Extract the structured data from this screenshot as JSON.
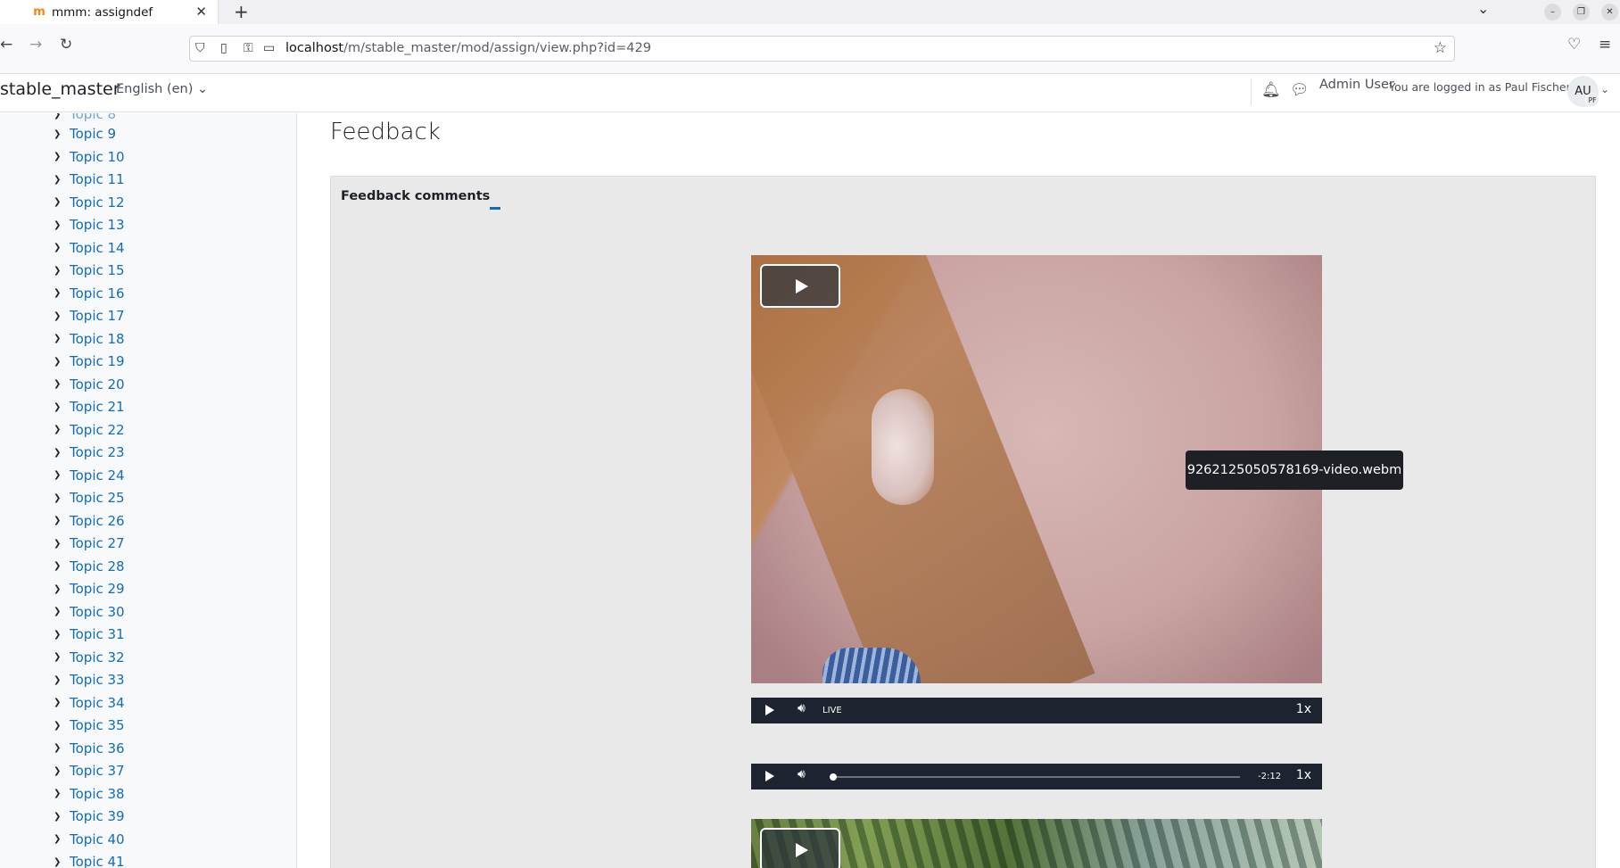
{
  "browser": {
    "tab_title": "mmm: assigndef",
    "url_host": "localhost",
    "url_path": "/m/stable_master/mod/assign/view.php?id=429"
  },
  "header": {
    "site_name": "stable_master",
    "language": "English (en) ⌄",
    "user_name": "Admin User",
    "logged_in_as": "You are logged in as Paul Fischer",
    "avatar_initials": "AU",
    "avatar_sub_initials": "PF"
  },
  "sidebar": {
    "topics": [
      "Topic 9",
      "Topic 10",
      "Topic 11",
      "Topic 12",
      "Topic 13",
      "Topic 14",
      "Topic 15",
      "Topic 16",
      "Topic 17",
      "Topic 18",
      "Topic 19",
      "Topic 20",
      "Topic 21",
      "Topic 22",
      "Topic 23",
      "Topic 24",
      "Topic 25",
      "Topic 26",
      "Topic 27",
      "Topic 28",
      "Topic 29",
      "Topic 30",
      "Topic 31",
      "Topic 32",
      "Topic 33",
      "Topic 34",
      "Topic 35",
      "Topic 36",
      "Topic 37",
      "Topic 38",
      "Topic 39",
      "Topic 40",
      "Topic 41"
    ]
  },
  "main": {
    "heading": "Feedback",
    "feedback_comments_label": "Feedback comments",
    "video_tooltip": "9262125050578169-video.webm",
    "player1": {
      "live_label": "LIVE",
      "rate": "1x"
    },
    "player2": {
      "time_remaining": "-2:12",
      "rate": "1x",
      "progress": 0.0
    }
  }
}
